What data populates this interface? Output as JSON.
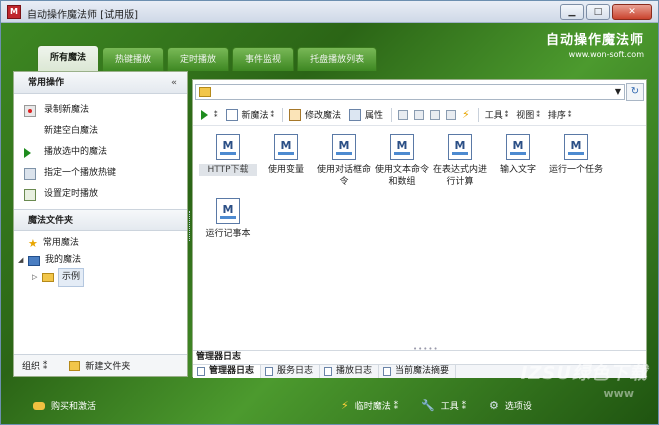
{
  "window": {
    "app_icon": "M",
    "title": "自动操作魔法师 [试用版]",
    "min": "▁",
    "max": "□",
    "close": "✕"
  },
  "brand": {
    "title": "自动操作魔法师",
    "url": "www.won-soft.com"
  },
  "tabs": [
    {
      "label": "所有魔法"
    },
    {
      "label": "热键播放"
    },
    {
      "label": "定时播放"
    },
    {
      "label": "事件监视"
    },
    {
      "label": "托盘播放列表"
    }
  ],
  "left": {
    "ops_title": "常用操作",
    "collapse": "«",
    "ops": [
      {
        "label": "录制新魔法",
        "icon": "record-icon"
      },
      {
        "label": "新建空白魔法",
        "icon": ""
      },
      {
        "label": "播放选中的魔法",
        "icon": "play-icon"
      },
      {
        "label": "指定一个播放热键",
        "icon": "keyboard-icon"
      },
      {
        "label": "设置定时播放",
        "icon": "clock-icon"
      }
    ],
    "folders_title": "魔法文件夹",
    "tree": {
      "common": "常用魔法",
      "mine": "我的魔法",
      "example": "示例"
    },
    "footer": {
      "organize": "组织 ⁑",
      "new_folder": "新建文件夹"
    }
  },
  "toolbar": {
    "play_caret": "⁑",
    "new_magic": "新魔法",
    "edit_magic": "修改魔法",
    "properties": "属性",
    "tools": "工具",
    "view": "视图",
    "sort": "排序",
    "caret": "⁑"
  },
  "magics": [
    {
      "label": "HTTP下载"
    },
    {
      "label": "使用变量"
    },
    {
      "label": "使用对话框命令"
    },
    {
      "label": "使用文本命令和数组"
    },
    {
      "label": "在表达式内进行计算"
    },
    {
      "label": "输入文字"
    },
    {
      "label": "运行一个任务"
    },
    {
      "label": "运行记事本"
    }
  ],
  "log": {
    "title": "管理器日志",
    "tabs": [
      {
        "label": "管理器日志"
      },
      {
        "label": "服务日志"
      },
      {
        "label": "播放日志"
      },
      {
        "label": "当前魔法摘要"
      }
    ]
  },
  "status": {
    "buy": "购买和激活",
    "temp_magic": "临时魔法 ⁑",
    "tools": "工具 ⁑",
    "options": "选项设"
  },
  "watermark": {
    "main": "IZSU绿色下载",
    "sub": "www"
  }
}
